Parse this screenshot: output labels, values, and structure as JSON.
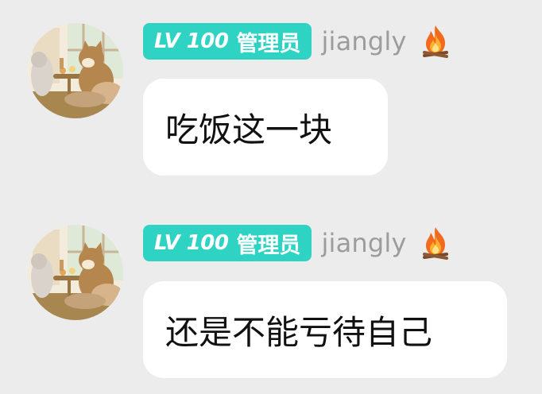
{
  "messages": [
    {
      "level_badge": "LV 100",
      "role_badge": "管理员",
      "username": "jiangly",
      "text": "吃饭这一块",
      "avatar_icon": "cat-avatar-icon",
      "status_icon": "fire-icon"
    },
    {
      "level_badge": "LV 100",
      "role_badge": "管理员",
      "username": "jiangly",
      "text": "还是不能亏待自己",
      "avatar_icon": "cat-avatar-icon",
      "status_icon": "fire-icon"
    }
  ],
  "colors": {
    "background": "#ececec",
    "badge": "#2fd3c3",
    "username": "#9c9c9c",
    "bubble": "#ffffff"
  }
}
